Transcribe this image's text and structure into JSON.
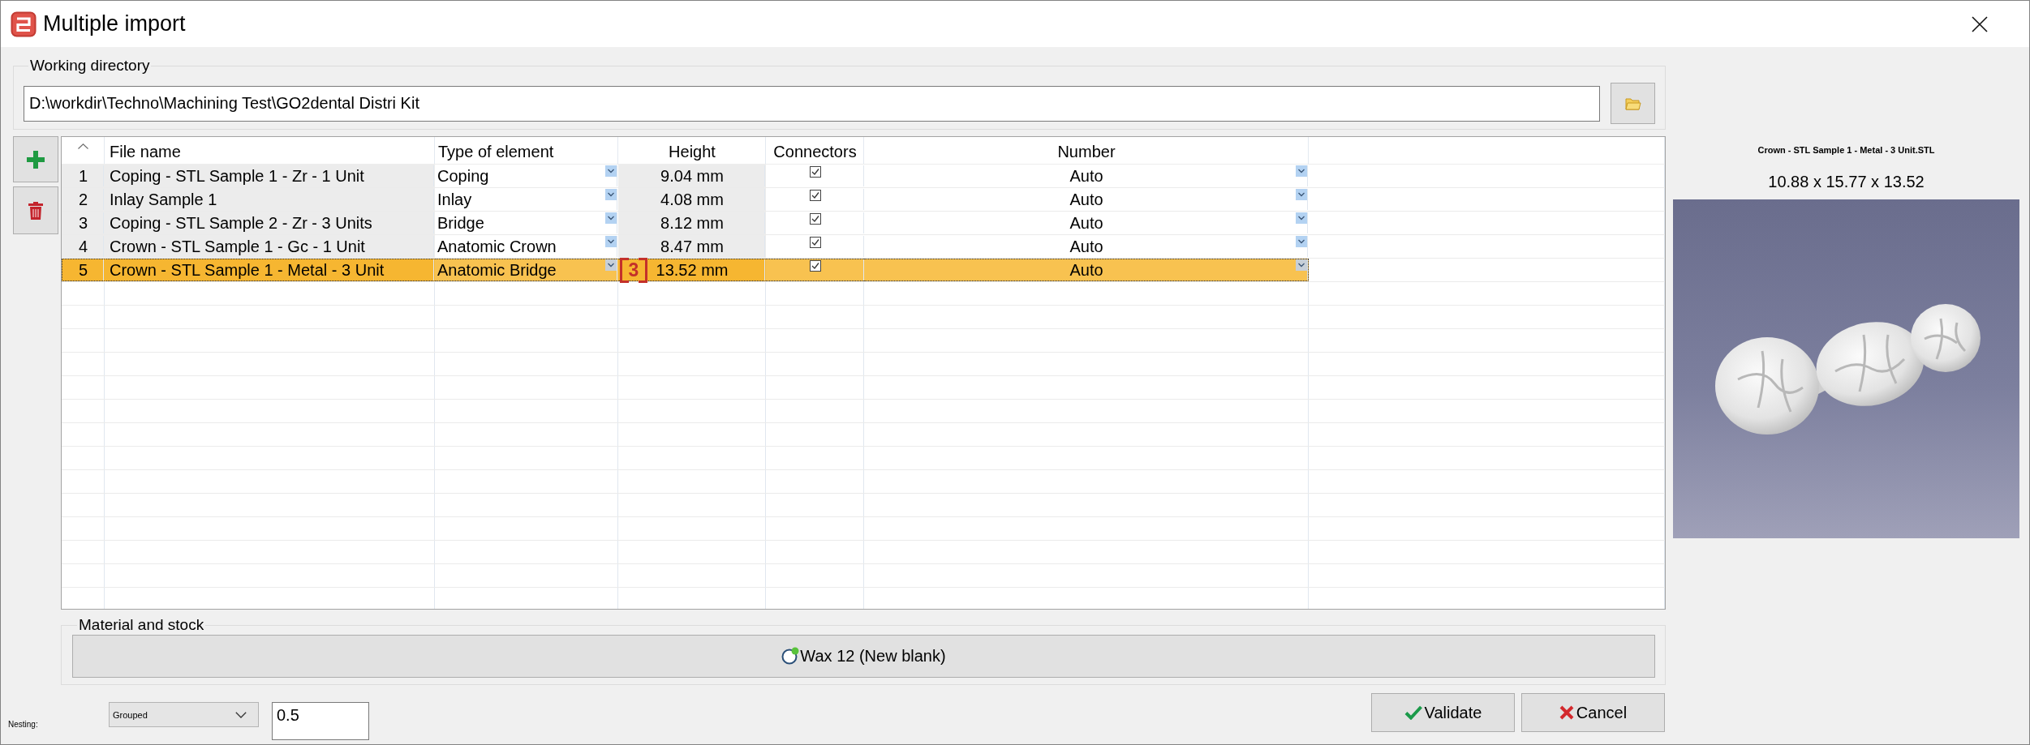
{
  "window": {
    "title": "Multiple import"
  },
  "working_directory": {
    "label": "Working directory",
    "value": "D:\\workdir\\Techno\\Machining Test\\GO2dental Distri Kit"
  },
  "table": {
    "columns": [
      "File name",
      "Type of element",
      "Height",
      "Connectors",
      "Number"
    ],
    "rows": [
      {
        "index": "1",
        "file_name": "Coping - STL Sample 1 - Zr - 1 Unit",
        "type": "Coping",
        "height": "9.04 mm",
        "connectors": true,
        "number": "Auto",
        "selected": false
      },
      {
        "index": "2",
        "file_name": "Inlay Sample 1",
        "type": "Inlay",
        "height": "4.08 mm",
        "connectors": true,
        "number": "Auto",
        "selected": false
      },
      {
        "index": "3",
        "file_name": "Coping - STL Sample 2 - Zr - 3 Units",
        "type": "Bridge",
        "height": "8.12 mm",
        "connectors": true,
        "number": "Auto",
        "selected": false
      },
      {
        "index": "4",
        "file_name": "Crown - STL Sample 1 - Gc - 1 Unit",
        "type": "Anatomic Crown",
        "height": "8.47 mm",
        "connectors": true,
        "number": "Auto",
        "selected": false
      },
      {
        "index": "5",
        "file_name": "Crown - STL Sample 1 - Metal - 3 Unit",
        "type": "Anatomic Bridge",
        "height": "13.52 mm",
        "connectors": true,
        "number": "Auto",
        "selected": true,
        "callout": "3"
      }
    ]
  },
  "preview": {
    "file_name": "Crown - STL Sample 1 - Metal - 3 Unit.STL",
    "dimensions": "10.88 x 15.77 x 13.52"
  },
  "material": {
    "label": "Material and stock",
    "stock": "Wax 12 (New blank)"
  },
  "nesting": {
    "label": "Nesting:",
    "mode": "Grouped",
    "value": "0.5"
  },
  "buttons": [
    {
      "kind": "validate",
      "label": "Validate"
    },
    {
      "kind": "cancel",
      "label": "Cancel"
    }
  ]
}
